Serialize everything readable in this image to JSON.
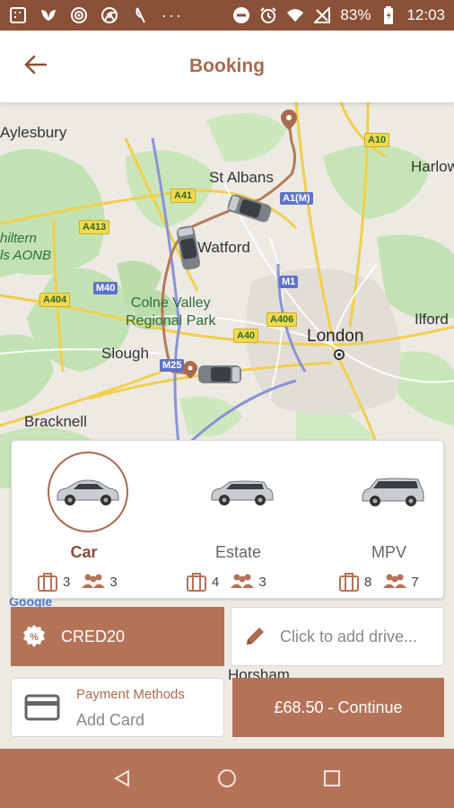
{
  "status_bar": {
    "battery": "83%",
    "time": "12:03",
    "left_icons": [
      "screenshot-icon",
      "leaf-icon",
      "target-icon",
      "chrome-icon",
      "moon-icon",
      "more-dots-icon"
    ],
    "right_icons": [
      "do-not-disturb-icon",
      "alarm-icon",
      "wifi-icon",
      "signal-icon",
      "battery-icon"
    ]
  },
  "header": {
    "title": "Booking",
    "back_icon": "arrow-left-icon"
  },
  "map": {
    "places": [
      "Aylesbury",
      "St Albans",
      "Harlow",
      "Watford",
      "Colne Valley\nRegional Park",
      "London",
      "Slough",
      "Ilford",
      "Bracknell",
      "Horsham"
    ],
    "aonb": "hiltern\nls AONB",
    "roads": [
      "A10",
      "A41",
      "A1(M)",
      "A413",
      "M40",
      "M1",
      "A404",
      "A406",
      "A40",
      "M25"
    ],
    "brand": "Google",
    "colors": {
      "route": "#b57a5a",
      "green": "#bfe0b0",
      "road_yellow": "#f6d94c",
      "pin": "#a86b4f"
    }
  },
  "vehicles": [
    {
      "name": "Car",
      "luggage": "3",
      "passengers": "3",
      "selected": true
    },
    {
      "name": "Estate",
      "luggage": "4",
      "passengers": "3",
      "selected": false
    },
    {
      "name": "MPV",
      "luggage": "8",
      "passengers": "7",
      "selected": false
    }
  ],
  "promo": {
    "code": "CRED20",
    "icon": "discount-badge-icon"
  },
  "driver": {
    "placeholder": "Click to add drive...",
    "icon": "pencil-icon"
  },
  "payment": {
    "label": "Payment Methods",
    "value": "Add Card",
    "icon": "credit-card-icon"
  },
  "continue": {
    "label": "£68.50 - Continue"
  },
  "nav": [
    "back-triangle-icon",
    "home-circle-icon",
    "recents-square-icon"
  ],
  "colors": {
    "accent": "#b47358",
    "accent_dark": "#8a5038",
    "title": "#a86b4f"
  }
}
